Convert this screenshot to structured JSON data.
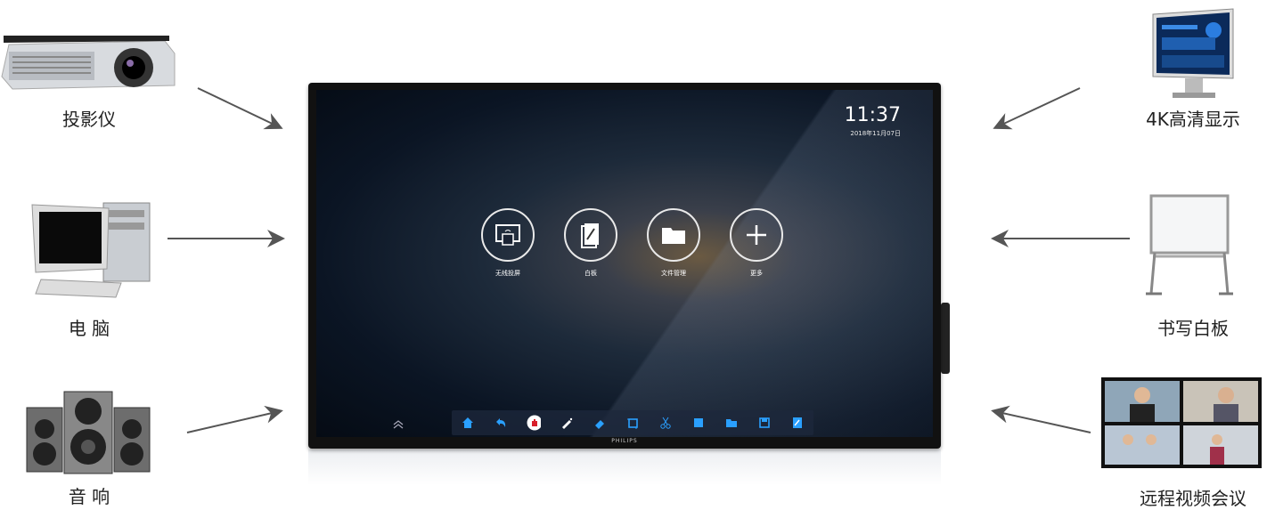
{
  "devices": {
    "projector": {
      "label": "投影仪"
    },
    "computer": {
      "label": "电 脑"
    },
    "speakers": {
      "label": "音 响"
    },
    "display4k": {
      "label": "4K高清显示"
    },
    "whiteboard": {
      "label": "书写白板"
    },
    "videoconf": {
      "label": "远程视频会议"
    }
  },
  "screen": {
    "time": "11:37",
    "date": "2018年11月07日",
    "apps": [
      {
        "label": "无线投屏",
        "icon": "cast-screen-icon"
      },
      {
        "label": "白板",
        "icon": "whiteboard-icon"
      },
      {
        "label": "文件管理",
        "icon": "folder-icon"
      },
      {
        "label": "更多",
        "icon": "plus-icon"
      }
    ],
    "toolbar_icons": [
      "home-icon",
      "undo-icon",
      "hand-icon",
      "pen-icon",
      "eraser-icon",
      "crop-icon",
      "scissors-icon",
      "square-icon",
      "folder-icon",
      "save-icon",
      "edit-file-icon"
    ],
    "brand": "PHILIPS"
  },
  "colors": {
    "accent_blue": "#2aa0ff",
    "arrow_gray": "#555555",
    "hand_red": "#d81e2a"
  }
}
